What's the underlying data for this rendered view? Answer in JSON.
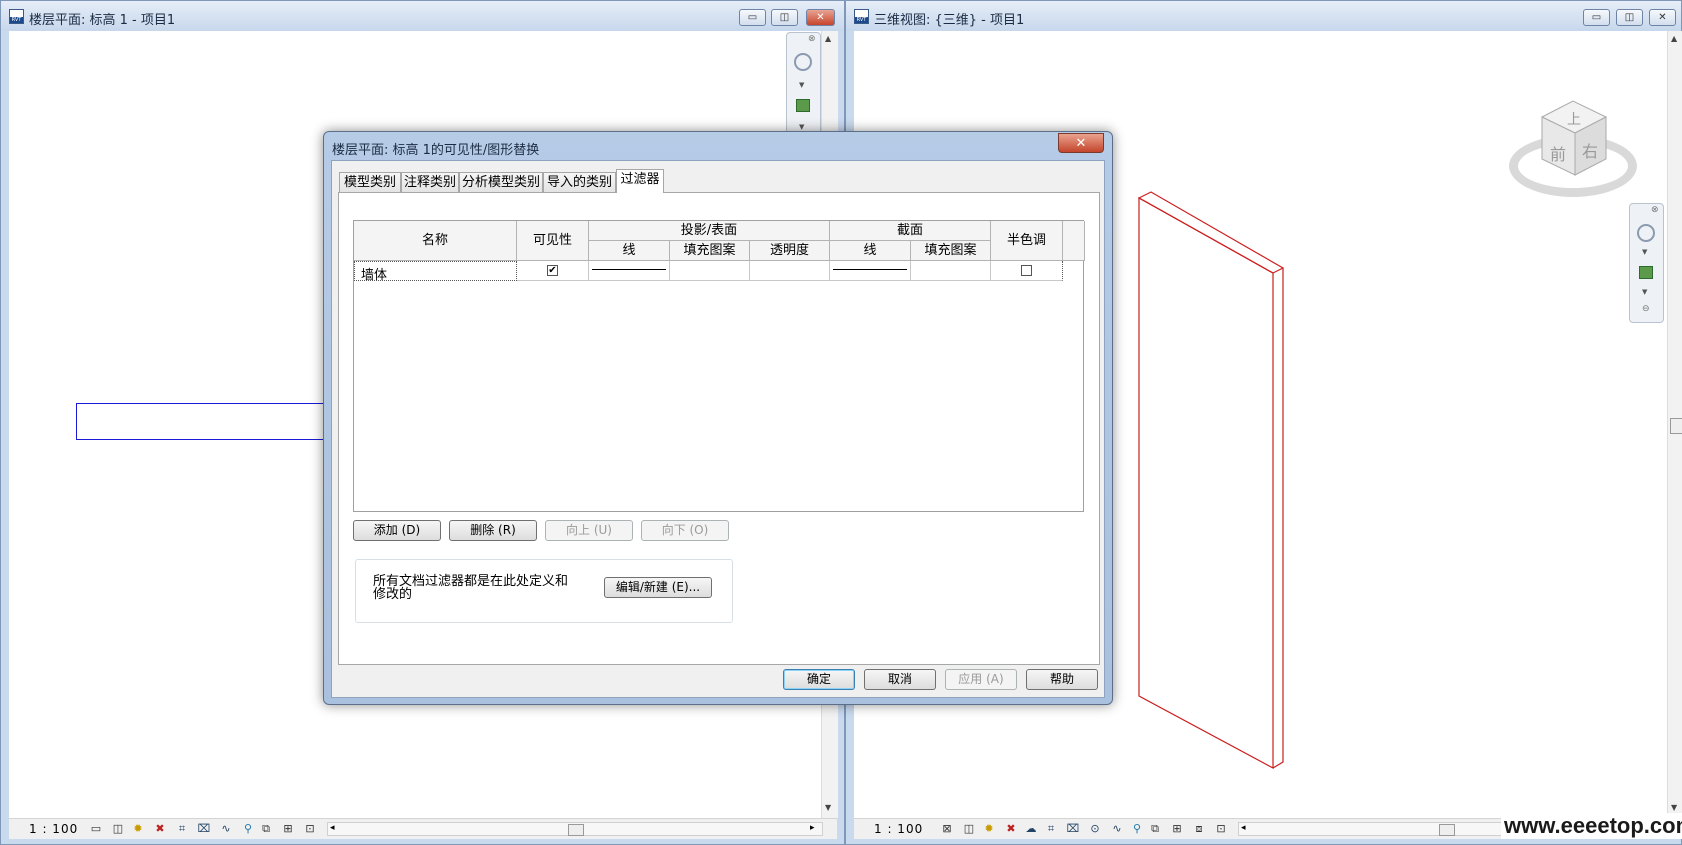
{
  "left_view": {
    "title": "楼层平面: 标高 1 - 项目1",
    "scale": "1 : 100",
    "icons": [
      "detail-level-icon",
      "visual-style-icon",
      "sun-path-icon",
      "shadows-icon",
      "crop-view-icon",
      "crop-region-icon",
      "temporary-hide-icon",
      "reveal-hidden-icon",
      "analytical-model-icon",
      "highlight-displacement-icon"
    ]
  },
  "right_view": {
    "title": "三维视图: {三维} - 项目1",
    "scale": "1 : 100",
    "viewcube": {
      "top": "上",
      "front": "前",
      "right": "右"
    }
  },
  "dialog": {
    "title": "楼层平面: 标高 1的可见性/图形替换",
    "close_symbol": "✕",
    "tabs": [
      "模型类别",
      "注释类别",
      "分析模型类别",
      "导入的类别",
      "过滤器"
    ],
    "active_tab": 4,
    "table": {
      "headers": {
        "name": "名称",
        "visibility": "可见性",
        "projection_group": "投影/表面",
        "cut_group": "截面",
        "halftone": "半色调",
        "proj_line": "线",
        "proj_fill": "填充图案",
        "proj_transparency": "透明度",
        "cut_line": "线",
        "cut_fill": "填充图案"
      },
      "rows": [
        {
          "name": "墙体",
          "visible": true,
          "halftone": false,
          "visible_mark": "✔",
          "halftone_mark": ""
        }
      ]
    },
    "buttons": {
      "add": "添加 (D)",
      "delete": "删除 (R)",
      "up": "向上 (U)",
      "down": "向下 (O)"
    },
    "note": "所有文档过滤器都是在此处定义和修改的",
    "edit_new": "编辑/新建 (E)...",
    "footer": {
      "ok": "确定",
      "cancel": "取消",
      "apply": "应用 (A)",
      "help": "帮助"
    }
  },
  "watermark": "www.eeeetop.com",
  "colors": {
    "wall_plan": "#1a1ad6",
    "wall_3d": "#cc1f1f"
  }
}
